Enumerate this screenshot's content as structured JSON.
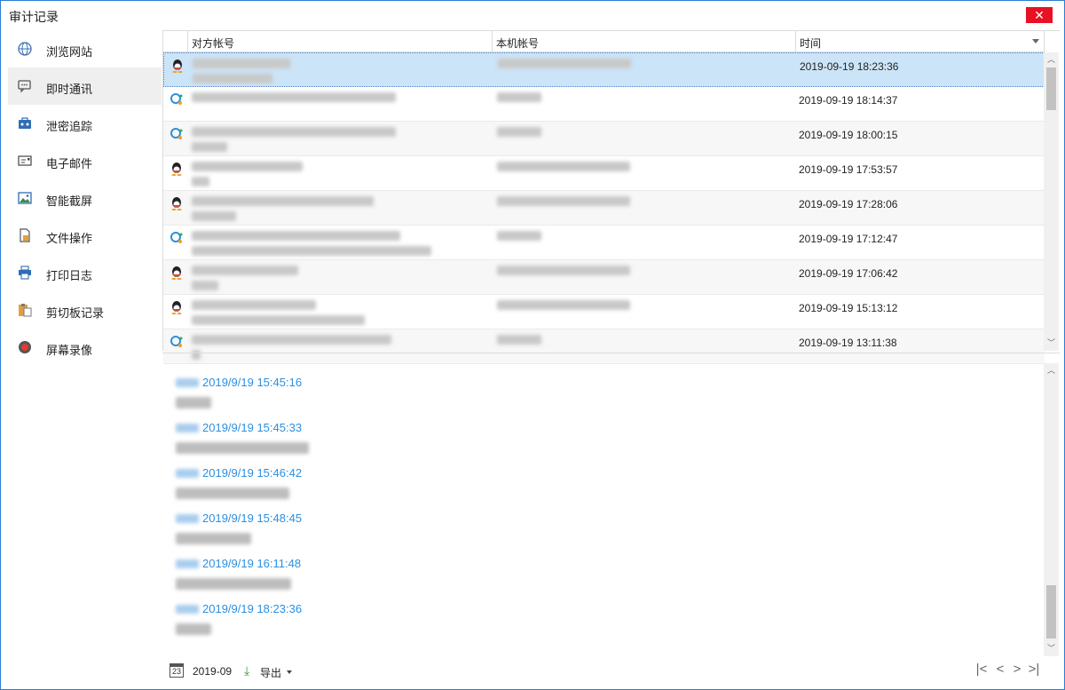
{
  "window": {
    "title": "审计记录",
    "close_label": "✕"
  },
  "sidebar": {
    "items": [
      {
        "label": "浏览网站",
        "icon": "globe-icon"
      },
      {
        "label": "即时通讯",
        "icon": "chat-icon",
        "active": true
      },
      {
        "label": "泄密追踪",
        "icon": "briefcase-icon"
      },
      {
        "label": "电子邮件",
        "icon": "mail-icon"
      },
      {
        "label": "智能截屏",
        "icon": "image-icon"
      },
      {
        "label": "文件操作",
        "icon": "file-icon"
      },
      {
        "label": "打印日志",
        "icon": "printer-icon"
      },
      {
        "label": "剪切板记录",
        "icon": "clipboard-icon"
      },
      {
        "label": "屏幕录像",
        "icon": "record-icon"
      }
    ]
  },
  "list": {
    "columns": [
      "对方帐号",
      "本机帐号",
      "时间"
    ],
    "rows": [
      {
        "app": "qq",
        "time": "2019-09-19 18:23:36"
      },
      {
        "app": "wechat-work",
        "time": "2019-09-19 18:14:37"
      },
      {
        "app": "wechat-work",
        "time": "2019-09-19 18:00:15"
      },
      {
        "app": "qq",
        "time": "2019-09-19 17:53:57"
      },
      {
        "app": "qq",
        "time": "2019-09-19 17:28:06"
      },
      {
        "app": "wechat-work",
        "time": "2019-09-19 17:12:47"
      },
      {
        "app": "qq",
        "time": "2019-09-19 17:06:42"
      },
      {
        "app": "qq",
        "time": "2019-09-19 15:13:12"
      },
      {
        "app": "wechat-work",
        "time": "2019-09-19 13:11:38"
      }
    ]
  },
  "detail": {
    "messages": [
      {
        "time": "2019/9/19 15:45:16"
      },
      {
        "time": "2019/9/19 15:45:33"
      },
      {
        "time": "2019/9/19 15:46:42"
      },
      {
        "time": "2019/9/19 15:48:45"
      },
      {
        "time": "2019/9/19 16:11:48"
      },
      {
        "time": "2019/9/19 18:23:36"
      }
    ]
  },
  "footer": {
    "calendar_day": "23",
    "month": "2019-09",
    "export_label": "导出",
    "pager": {
      "first": "|<",
      "prev": "<",
      "next": ">",
      "last": ">|"
    }
  },
  "colors": {
    "accent": "#2b8fe0",
    "selected_row": "#cce4f7",
    "close": "#e81123"
  }
}
